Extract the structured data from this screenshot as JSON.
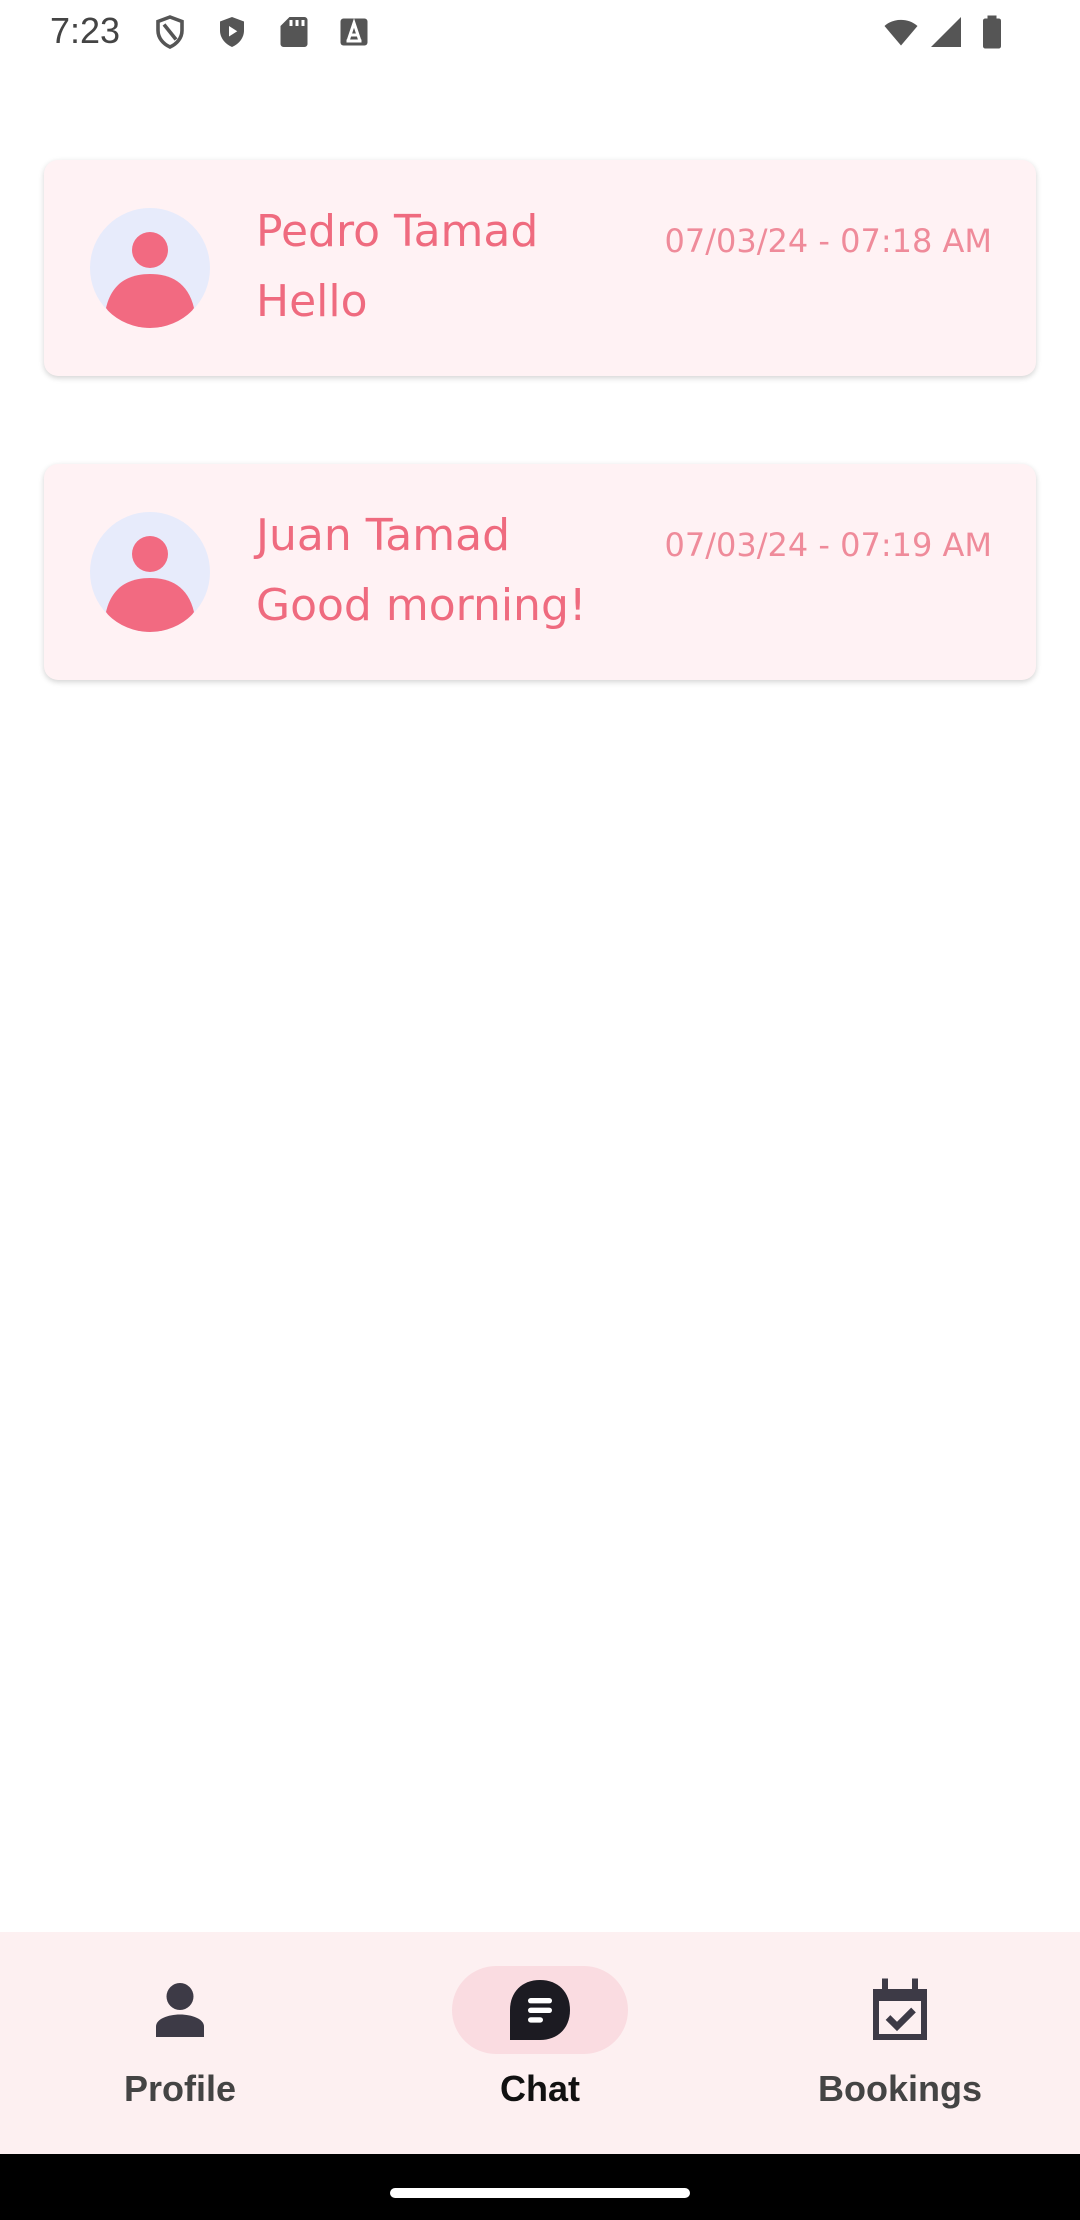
{
  "status_bar": {
    "time": "7:23",
    "icons": [
      "shield-outline-icon",
      "shield-play-icon",
      "sd-card-icon",
      "font-a-icon",
      "wifi-icon",
      "signal-icon",
      "battery-icon"
    ]
  },
  "chats": [
    {
      "name": "Pedro Tamad",
      "message": "Hello",
      "timestamp": "07/03/24 - 07:18 AM",
      "avatar": "person-avatar-icon"
    },
    {
      "name": "Juan Tamad",
      "message": "Good morning!",
      "timestamp": "07/03/24 - 07:19 AM",
      "avatar": "person-avatar-icon"
    }
  ],
  "bottom_nav": {
    "items": [
      {
        "label": "Profile",
        "icon": "person-icon",
        "active": false
      },
      {
        "label": "Chat",
        "icon": "chat-bubble-icon",
        "active": true
      },
      {
        "label": "Bookings",
        "icon": "calendar-check-icon",
        "active": false
      }
    ]
  },
  "colors": {
    "accent": "#ef6b7f",
    "card_bg": "#fff2f4",
    "avatar_bg": "#e7ebfb",
    "nav_bg": "#fdf0f1",
    "nav_active_pill": "#fadce1"
  }
}
